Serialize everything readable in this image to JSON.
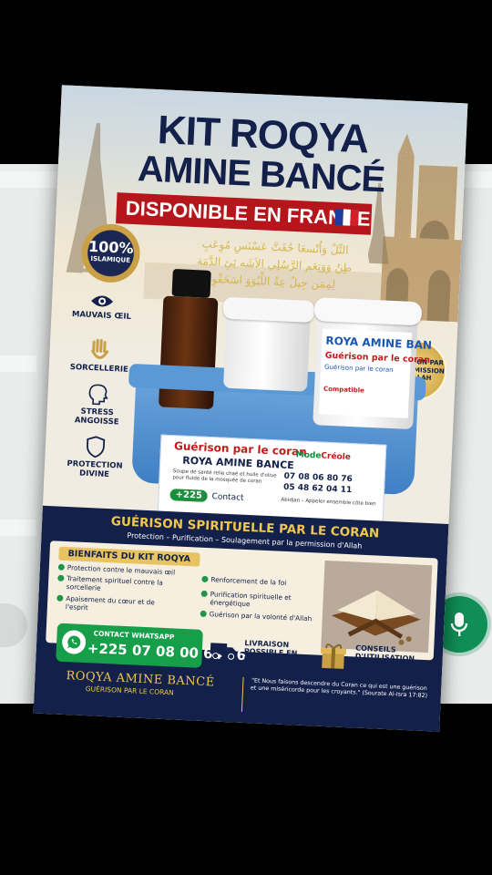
{
  "background": {
    "page_color": "#000000",
    "chat_panel_color": "#e9eceb",
    "mic_button_color": "#0f8f55"
  },
  "mic_button": {
    "icon": "microphone-icon"
  },
  "poster": {
    "title_line1": "KIT ROQYA",
    "title_line2": "AMINE BANCÉ",
    "availability": "DISPONIBLE EN FRANCE",
    "seal": {
      "percent": "100%",
      "label": "ISLAMIQUE"
    },
    "arabic_verse": "التِّلْ وَاُتّسعَا حُقَتَّ عَسْنَسِ مُوِعَبِ طِنُ وَوَتِعَم الرَّسُلِي الاَشَه ثِئِ الدَّمَة لِمِمَن جِيلُ عِةُ اللِّيُوَوَ اسَحَقْوِ",
    "side_items": [
      {
        "icon": "eye-icon",
        "label": "MAUVAIS ŒIL"
      },
      {
        "icon": "hamsa-hand-icon",
        "label": "SORCELLERIE"
      },
      {
        "icon": "head-profile-icon",
        "label": "STRESS ANGOISSE"
      },
      {
        "icon": "shield-icon",
        "label": "PROTECTION DIVINE"
      }
    ],
    "gold_badge": "GUÉRISON PAR LA PERMISSION D'ALLAH",
    "jar_label": {
      "brand": "ROYA AMINE BAN",
      "tagline": "Guérison par le coran",
      "line": "Guérison par le coran",
      "compat": "Compatible"
    },
    "tub_label": {
      "title": "Guérison par le coran",
      "name": "ROYA AMINE BANCE",
      "description": "Soupe de santé relie chaé et huile d'olive pour fluide de la mosquée de coran",
      "brand_a": "Mode",
      "brand_b": "Créole",
      "phone1": "07 08 06 80 76",
      "phone2": "05 48 62 04 11",
      "country_code": "+225",
      "contact": "Contact",
      "address": "Abidjan – Appeler ensemble côte bien"
    },
    "section_title": "GUÉRISON SPIRITUELLE PAR LE CORAN",
    "section_subtitle": "Protection – Purification – Soulagement par la permission d'Allah",
    "benefits_title": "BIENFAITS DU KIT ROQYA",
    "benefits_left": [
      "Protection contre le mauvais œil",
      "Traitement spirituel contre la sorcellerie",
      "Apaisement du cœur et de l'esprit"
    ],
    "benefits_right": [
      "Renforcement de la foi",
      "Purification spirituelle et énergétique",
      "Guérison par la volonté d'Allah"
    ],
    "whatsapp": {
      "label": "CONTACT WHATSAPP",
      "number": "+225 07 08 00 64 76",
      "icon": "whatsapp-icon"
    },
    "delivery": {
      "icon": "truck-icon",
      "text": "LIVRAISON POSSIBLE EN FRANCE"
    },
    "advice": {
      "icon": "gift-box-icon",
      "text": "CONSEILS D'UTILISATION INCLUS"
    },
    "footer": {
      "name": "ROQYA AMINE BANCÉ",
      "subtitle": "GUÉRISON PAR LE CORAN",
      "quote": "\"Et Nous faisons descendre du Coran ce qui est une guérison et une miséricorde pour les croyants.\" (Sourate Al-Isra 17:82)"
    },
    "colors": {
      "navy": "#12204a",
      "red": "#b4161b",
      "gold": "#f0c64e",
      "green": "#169f48"
    }
  }
}
